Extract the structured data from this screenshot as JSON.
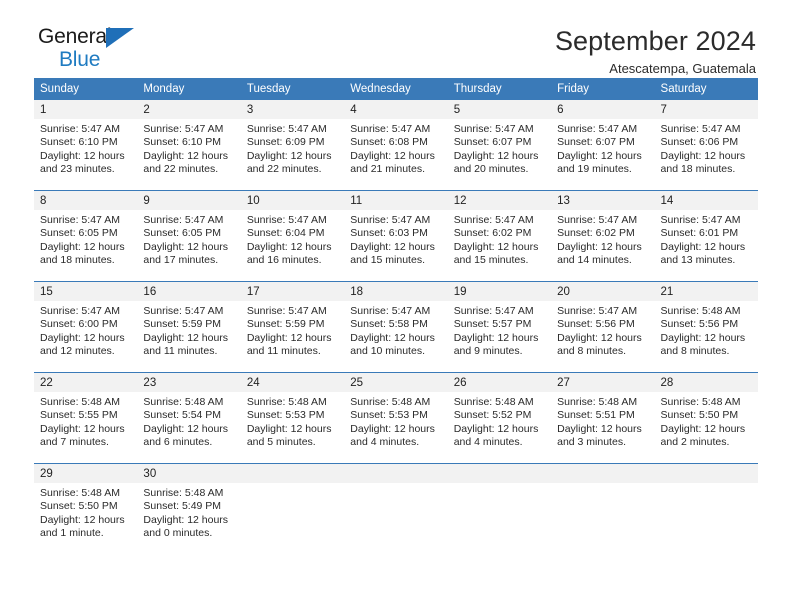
{
  "brand": {
    "name_top": "General",
    "name_bottom": "Blue",
    "accent_color": "#1f7bc1"
  },
  "header": {
    "title": "September 2024",
    "subtitle": "Atescatempa, Guatemala"
  },
  "theme": {
    "header_bg": "#3a7ab8",
    "daynum_bg": "#f2f2f2",
    "text_color": "#2a2a2a"
  },
  "calendar": {
    "weekday_headers": [
      "Sunday",
      "Monday",
      "Tuesday",
      "Wednesday",
      "Thursday",
      "Friday",
      "Saturday"
    ],
    "weeks": [
      [
        {
          "day": "1",
          "sunrise": "Sunrise: 5:47 AM",
          "sunset": "Sunset: 6:10 PM",
          "daylight_line1": "Daylight: 12 hours",
          "daylight_line2": "and 23 minutes."
        },
        {
          "day": "2",
          "sunrise": "Sunrise: 5:47 AM",
          "sunset": "Sunset: 6:10 PM",
          "daylight_line1": "Daylight: 12 hours",
          "daylight_line2": "and 22 minutes."
        },
        {
          "day": "3",
          "sunrise": "Sunrise: 5:47 AM",
          "sunset": "Sunset: 6:09 PM",
          "daylight_line1": "Daylight: 12 hours",
          "daylight_line2": "and 22 minutes."
        },
        {
          "day": "4",
          "sunrise": "Sunrise: 5:47 AM",
          "sunset": "Sunset: 6:08 PM",
          "daylight_line1": "Daylight: 12 hours",
          "daylight_line2": "and 21 minutes."
        },
        {
          "day": "5",
          "sunrise": "Sunrise: 5:47 AM",
          "sunset": "Sunset: 6:07 PM",
          "daylight_line1": "Daylight: 12 hours",
          "daylight_line2": "and 20 minutes."
        },
        {
          "day": "6",
          "sunrise": "Sunrise: 5:47 AM",
          "sunset": "Sunset: 6:07 PM",
          "daylight_line1": "Daylight: 12 hours",
          "daylight_line2": "and 19 minutes."
        },
        {
          "day": "7",
          "sunrise": "Sunrise: 5:47 AM",
          "sunset": "Sunset: 6:06 PM",
          "daylight_line1": "Daylight: 12 hours",
          "daylight_line2": "and 18 minutes."
        }
      ],
      [
        {
          "day": "8",
          "sunrise": "Sunrise: 5:47 AM",
          "sunset": "Sunset: 6:05 PM",
          "daylight_line1": "Daylight: 12 hours",
          "daylight_line2": "and 18 minutes."
        },
        {
          "day": "9",
          "sunrise": "Sunrise: 5:47 AM",
          "sunset": "Sunset: 6:05 PM",
          "daylight_line1": "Daylight: 12 hours",
          "daylight_line2": "and 17 minutes."
        },
        {
          "day": "10",
          "sunrise": "Sunrise: 5:47 AM",
          "sunset": "Sunset: 6:04 PM",
          "daylight_line1": "Daylight: 12 hours",
          "daylight_line2": "and 16 minutes."
        },
        {
          "day": "11",
          "sunrise": "Sunrise: 5:47 AM",
          "sunset": "Sunset: 6:03 PM",
          "daylight_line1": "Daylight: 12 hours",
          "daylight_line2": "and 15 minutes."
        },
        {
          "day": "12",
          "sunrise": "Sunrise: 5:47 AM",
          "sunset": "Sunset: 6:02 PM",
          "daylight_line1": "Daylight: 12 hours",
          "daylight_line2": "and 15 minutes."
        },
        {
          "day": "13",
          "sunrise": "Sunrise: 5:47 AM",
          "sunset": "Sunset: 6:02 PM",
          "daylight_line1": "Daylight: 12 hours",
          "daylight_line2": "and 14 minutes."
        },
        {
          "day": "14",
          "sunrise": "Sunrise: 5:47 AM",
          "sunset": "Sunset: 6:01 PM",
          "daylight_line1": "Daylight: 12 hours",
          "daylight_line2": "and 13 minutes."
        }
      ],
      [
        {
          "day": "15",
          "sunrise": "Sunrise: 5:47 AM",
          "sunset": "Sunset: 6:00 PM",
          "daylight_line1": "Daylight: 12 hours",
          "daylight_line2": "and 12 minutes."
        },
        {
          "day": "16",
          "sunrise": "Sunrise: 5:47 AM",
          "sunset": "Sunset: 5:59 PM",
          "daylight_line1": "Daylight: 12 hours",
          "daylight_line2": "and 11 minutes."
        },
        {
          "day": "17",
          "sunrise": "Sunrise: 5:47 AM",
          "sunset": "Sunset: 5:59 PM",
          "daylight_line1": "Daylight: 12 hours",
          "daylight_line2": "and 11 minutes."
        },
        {
          "day": "18",
          "sunrise": "Sunrise: 5:47 AM",
          "sunset": "Sunset: 5:58 PM",
          "daylight_line1": "Daylight: 12 hours",
          "daylight_line2": "and 10 minutes."
        },
        {
          "day": "19",
          "sunrise": "Sunrise: 5:47 AM",
          "sunset": "Sunset: 5:57 PM",
          "daylight_line1": "Daylight: 12 hours",
          "daylight_line2": "and 9 minutes."
        },
        {
          "day": "20",
          "sunrise": "Sunrise: 5:47 AM",
          "sunset": "Sunset: 5:56 PM",
          "daylight_line1": "Daylight: 12 hours",
          "daylight_line2": "and 8 minutes."
        },
        {
          "day": "21",
          "sunrise": "Sunrise: 5:48 AM",
          "sunset": "Sunset: 5:56 PM",
          "daylight_line1": "Daylight: 12 hours",
          "daylight_line2": "and 8 minutes."
        }
      ],
      [
        {
          "day": "22",
          "sunrise": "Sunrise: 5:48 AM",
          "sunset": "Sunset: 5:55 PM",
          "daylight_line1": "Daylight: 12 hours",
          "daylight_line2": "and 7 minutes."
        },
        {
          "day": "23",
          "sunrise": "Sunrise: 5:48 AM",
          "sunset": "Sunset: 5:54 PM",
          "daylight_line1": "Daylight: 12 hours",
          "daylight_line2": "and 6 minutes."
        },
        {
          "day": "24",
          "sunrise": "Sunrise: 5:48 AM",
          "sunset": "Sunset: 5:53 PM",
          "daylight_line1": "Daylight: 12 hours",
          "daylight_line2": "and 5 minutes."
        },
        {
          "day": "25",
          "sunrise": "Sunrise: 5:48 AM",
          "sunset": "Sunset: 5:53 PM",
          "daylight_line1": "Daylight: 12 hours",
          "daylight_line2": "and 4 minutes."
        },
        {
          "day": "26",
          "sunrise": "Sunrise: 5:48 AM",
          "sunset": "Sunset: 5:52 PM",
          "daylight_line1": "Daylight: 12 hours",
          "daylight_line2": "and 4 minutes."
        },
        {
          "day": "27",
          "sunrise": "Sunrise: 5:48 AM",
          "sunset": "Sunset: 5:51 PM",
          "daylight_line1": "Daylight: 12 hours",
          "daylight_line2": "and 3 minutes."
        },
        {
          "day": "28",
          "sunrise": "Sunrise: 5:48 AM",
          "sunset": "Sunset: 5:50 PM",
          "daylight_line1": "Daylight: 12 hours",
          "daylight_line2": "and 2 minutes."
        }
      ],
      [
        {
          "day": "29",
          "sunrise": "Sunrise: 5:48 AM",
          "sunset": "Sunset: 5:50 PM",
          "daylight_line1": "Daylight: 12 hours",
          "daylight_line2": "and 1 minute."
        },
        {
          "day": "30",
          "sunrise": "Sunrise: 5:48 AM",
          "sunset": "Sunset: 5:49 PM",
          "daylight_line1": "Daylight: 12 hours",
          "daylight_line2": "and 0 minutes."
        },
        {
          "day": "",
          "sunrise": "",
          "sunset": "",
          "daylight_line1": "",
          "daylight_line2": ""
        },
        {
          "day": "",
          "sunrise": "",
          "sunset": "",
          "daylight_line1": "",
          "daylight_line2": ""
        },
        {
          "day": "",
          "sunrise": "",
          "sunset": "",
          "daylight_line1": "",
          "daylight_line2": ""
        },
        {
          "day": "",
          "sunrise": "",
          "sunset": "",
          "daylight_line1": "",
          "daylight_line2": ""
        },
        {
          "day": "",
          "sunrise": "",
          "sunset": "",
          "daylight_line1": "",
          "daylight_line2": ""
        }
      ]
    ]
  }
}
